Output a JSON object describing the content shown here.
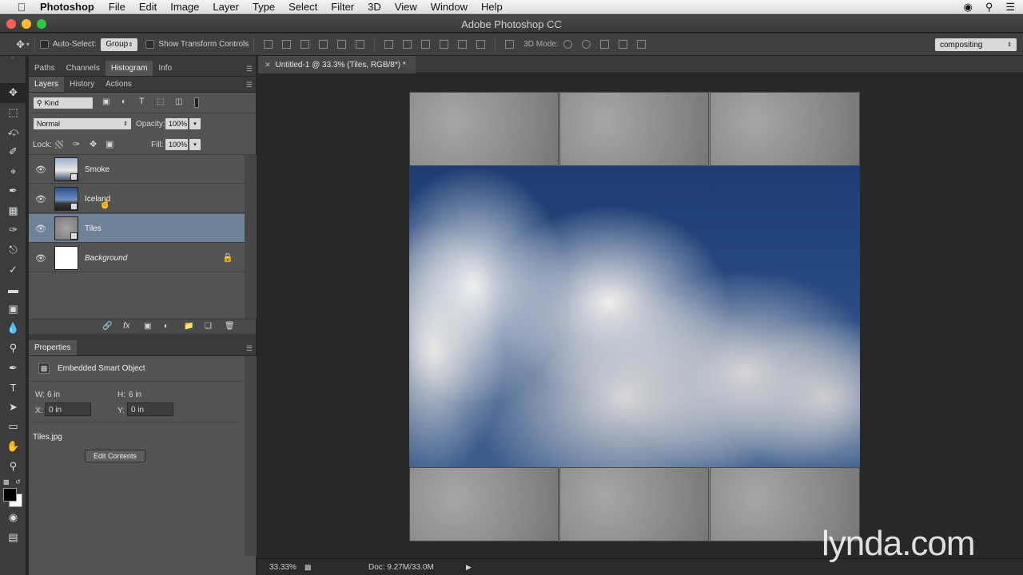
{
  "menubar": {
    "app_name": "Photoshop",
    "items": [
      "File",
      "Edit",
      "Image",
      "Layer",
      "Type",
      "Select",
      "Filter",
      "3D",
      "View",
      "Window",
      "Help"
    ]
  },
  "window": {
    "title": "Adobe Photoshop CC"
  },
  "options": {
    "auto_select_label": "Auto-Select:",
    "auto_select_value": "Group",
    "show_transform_label": "Show Transform Controls",
    "mode_3d_label": "3D Mode:",
    "workspace": "compositing"
  },
  "panels": {
    "top_tabs": [
      "Paths",
      "Channels",
      "Histogram",
      "Info"
    ],
    "top_active": "Histogram",
    "layer_tabs": [
      "Layers",
      "History",
      "Actions"
    ],
    "layer_active": "Layers",
    "filter_kind": "Kind",
    "blend_mode": "Normal",
    "opacity_label": "Opacity:",
    "opacity_value": "100%",
    "lock_label": "Lock:",
    "fill_label": "Fill:",
    "fill_value": "100%",
    "layers": [
      {
        "name": "Smoke",
        "selected": false
      },
      {
        "name": "Iceland",
        "selected": false
      },
      {
        "name": "Tiles",
        "selected": true
      },
      {
        "name": "Background",
        "selected": false,
        "locked": true
      }
    ],
    "properties": {
      "tab": "Properties",
      "type": "Embedded Smart Object",
      "w_label": "W:",
      "w_value": "6 in",
      "h_label": "H:",
      "h_value": "6 in",
      "x_label": "X:",
      "x_value": "0 in",
      "y_label": "Y:",
      "y_value": "0 in",
      "file": "Tiles.jpg",
      "edit_button": "Edit Contents"
    }
  },
  "document": {
    "tab_title": "Untitled-1 @ 33.3% (Tiles, RGB/8*) *",
    "zoom": "33.33%",
    "doc_size": "Doc: 9.27M/33.0M"
  },
  "watermark": "lynda.com"
}
